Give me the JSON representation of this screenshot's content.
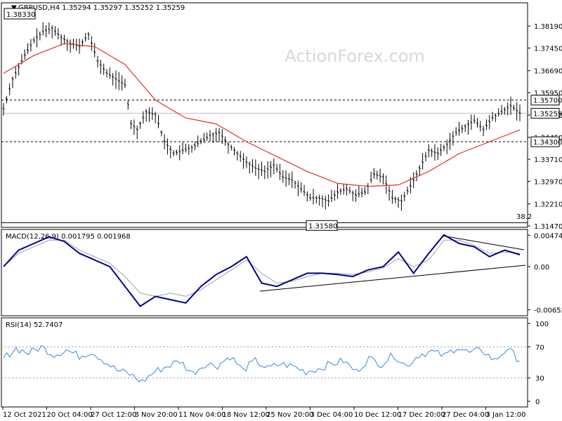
{
  "header": {
    "symbol": "GBPUSD,H4",
    "ohlc": "1.35294 1.35297 1.35252 1.35259"
  },
  "watermark": "ActionForex.com",
  "colors": {
    "price": "#000000",
    "ema": "#e0302a",
    "macd": "#00008b",
    "signal": "#a0a0a0",
    "rsi": "#3a8ad8"
  },
  "chart_data": [
    {
      "type": "ohlc",
      "ylim": [
        1.3147,
        1.3883
      ],
      "yticks": [
        "1.38190",
        "1.37450",
        "1.36690",
        "1.35950",
        "1.35200",
        "1.34450",
        "1.33710",
        "1.32970",
        "1.32210",
        "1.31470"
      ],
      "levels": [
        {
          "label": "1.38330",
          "value": 1.3833,
          "style": "box"
        },
        {
          "label": "1.35700",
          "value": 1.357,
          "style": "dashed"
        },
        {
          "label": "1.35259",
          "value": 1.35259,
          "style": "current"
        },
        {
          "label": "1.34300",
          "value": 1.343,
          "style": "dashed"
        },
        {
          "label": "1.31580",
          "value": 1.3158,
          "style": "solid"
        }
      ],
      "fib_label": "38.2",
      "close_path": [
        [
          0,
          1.354
        ],
        [
          3,
          1.364
        ],
        [
          7,
          1.372
        ],
        [
          10,
          1.377
        ],
        [
          13,
          1.38
        ],
        [
          16,
          1.381
        ],
        [
          19,
          1.378
        ],
        [
          22,
          1.376
        ],
        [
          25,
          1.375
        ],
        [
          28,
          1.379
        ],
        [
          31,
          1.37
        ],
        [
          34,
          1.366
        ],
        [
          37,
          1.364
        ],
        [
          40,
          1.362
        ],
        [
          42,
          1.349
        ],
        [
          44,
          1.347
        ],
        [
          47,
          1.353
        ],
        [
          50,
          1.352
        ],
        [
          53,
          1.343
        ],
        [
          56,
          1.339
        ],
        [
          59,
          1.34
        ],
        [
          62,
          1.341
        ],
        [
          65,
          1.343
        ],
        [
          68,
          1.345
        ],
        [
          71,
          1.346
        ],
        [
          74,
          1.342
        ],
        [
          77,
          1.339
        ],
        [
          80,
          1.336
        ],
        [
          83,
          1.334
        ],
        [
          86,
          1.333
        ],
        [
          89,
          1.335
        ],
        [
          92,
          1.331
        ],
        [
          95,
          1.33
        ],
        [
          98,
          1.327
        ],
        [
          101,
          1.324
        ],
        [
          104,
          1.324
        ],
        [
          107,
          1.323
        ],
        [
          110,
          1.326
        ],
        [
          113,
          1.327
        ],
        [
          116,
          1.325
        ],
        [
          119,
          1.326
        ],
        [
          122,
          1.332
        ],
        [
          125,
          1.331
        ],
        [
          128,
          1.324
        ],
        [
          131,
          1.323
        ],
        [
          134,
          1.328
        ],
        [
          137,
          1.334
        ],
        [
          140,
          1.34
        ],
        [
          143,
          1.339
        ],
        [
          146,
          1.342
        ],
        [
          149,
          1.346
        ],
        [
          152,
          1.348
        ],
        [
          155,
          1.35
        ],
        [
          158,
          1.347
        ],
        [
          161,
          1.351
        ],
        [
          164,
          1.353
        ],
        [
          167,
          1.355
        ],
        [
          170,
          1.3526
        ]
      ],
      "ema_path": [
        [
          0,
          1.366
        ],
        [
          10,
          1.372
        ],
        [
          20,
          1.376
        ],
        [
          30,
          1.375
        ],
        [
          40,
          1.369
        ],
        [
          50,
          1.357
        ],
        [
          60,
          1.351
        ],
        [
          70,
          1.349
        ],
        [
          80,
          1.343
        ],
        [
          90,
          1.338
        ],
        [
          100,
          1.333
        ],
        [
          110,
          1.329
        ],
        [
          120,
          1.328
        ],
        [
          130,
          1.3285
        ],
        [
          140,
          1.333
        ],
        [
          150,
          1.339
        ],
        [
          160,
          1.343
        ],
        [
          170,
          1.347
        ]
      ]
    },
    {
      "type": "line",
      "title": "MACD(12,26,9) 0.001795 0.001968",
      "ylim": [
        -0.0069,
        0.0053
      ],
      "yticks": [
        "0.00474",
        "0.00",
        "-0.006526"
      ],
      "series": [
        {
          "name": "MACD",
          "values": [
            0.0,
            0.0025,
            0.0035,
            0.0045,
            0.0038,
            0.002,
            0.001,
            0.0,
            -0.003,
            -0.006,
            -0.0045,
            -0.005,
            -0.0055,
            -0.003,
            -0.0012,
            0.0,
            0.0015,
            -0.0025,
            -0.003,
            -0.002,
            -0.001,
            -0.001,
            -0.0012,
            -0.0015,
            -0.0005,
            0.0,
            0.0022,
            -0.001,
            0.002,
            0.0048,
            0.0035,
            0.003,
            0.0015,
            0.0025,
            0.0018
          ]
        },
        {
          "name": "Signal",
          "values": [
            0.0,
            0.002,
            0.003,
            0.004,
            0.004,
            0.0025,
            0.0015,
            0.0005,
            -0.0015,
            -0.004,
            -0.0045,
            -0.004,
            -0.0045,
            -0.0035,
            -0.002,
            -0.0005,
            0.001,
            -0.001,
            -0.0025,
            -0.0022,
            -0.0015,
            -0.001,
            -0.001,
            -0.0012,
            -0.0008,
            -0.0002,
            0.0012,
            0.0,
            0.001,
            0.004,
            0.004,
            0.0032,
            0.002,
            0.0022,
            0.002
          ]
        }
      ],
      "trendlines": [
        [
          [
            -0.0032,
            0.0
          ],
          [
            0.0,
            0.0
          ]
        ]
      ]
    },
    {
      "type": "line",
      "title": "RSI(14) 52.7407",
      "ylim": [
        0,
        100
      ],
      "yticks": [
        "100",
        "70",
        "30",
        "0"
      ],
      "series": [
        {
          "name": "RSI",
          "values": [
            55,
            68,
            62,
            70,
            60,
            66,
            58,
            64,
            52,
            40,
            35,
            25,
            38,
            45,
            52,
            36,
            48,
            46,
            58,
            40,
            52,
            42,
            48,
            45,
            38,
            42,
            48,
            52,
            38,
            55,
            48,
            60,
            45,
            60,
            64,
            58,
            70,
            62,
            66,
            52,
            68,
            52
          ]
        }
      ]
    }
  ],
  "xticks": [
    "12 Oct 2021",
    "20 Oct 04:00",
    "27 Oct 12:00",
    "3 Nov 20:00",
    "11 Nov 04:00",
    "18 Nov 12:00",
    "25 Nov 20:00",
    "3 Dec 04:00",
    "10 Dec 12:00",
    "17 Dec 20:00",
    "27 Dec 04:00",
    "3 Jan 12:00"
  ]
}
